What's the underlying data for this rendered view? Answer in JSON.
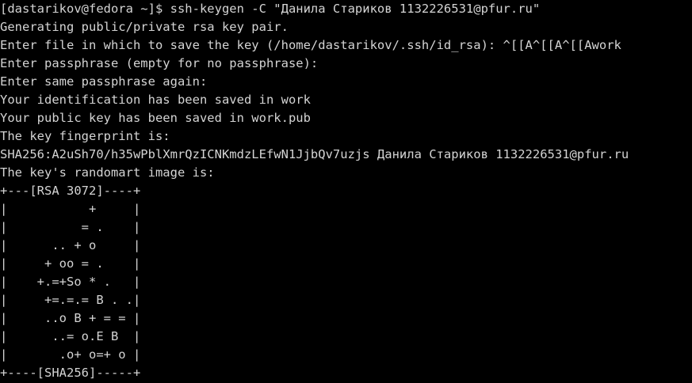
{
  "terminal": {
    "lines": [
      "[dastarikov@fedora ~]$ ssh-keygen -C \"Данила Стариков 1132226531@pfur.ru\"",
      "Generating public/private rsa key pair.",
      "Enter file in which to save the key (/home/dastarikov/.ssh/id_rsa): ^[[A^[[A^[[Awork",
      "Enter passphrase (empty for no passphrase):",
      "Enter same passphrase again:",
      "Your identification has been saved in work",
      "Your public key has been saved in work.pub",
      "The key fingerprint is:",
      "SHA256:A2uSh70/h35wPblXmrQzICNKmdzLEfwN1JjbQv7uzjs Данила Стариков 1132226531@pfur.ru",
      "The key's randomart image is:",
      "+---[RSA 3072]----+",
      "|           +     |",
      "|          = .    |",
      "|      .. + o     |",
      "|     + oo = .    |",
      "|    +.=+So * .   |",
      "|     +=.=.= B . .|",
      "|     ..o B + = = |",
      "|      ..= o.E B  |",
      "|       .o+ o=+ o |",
      "+----[SHA256]-----+"
    ]
  }
}
